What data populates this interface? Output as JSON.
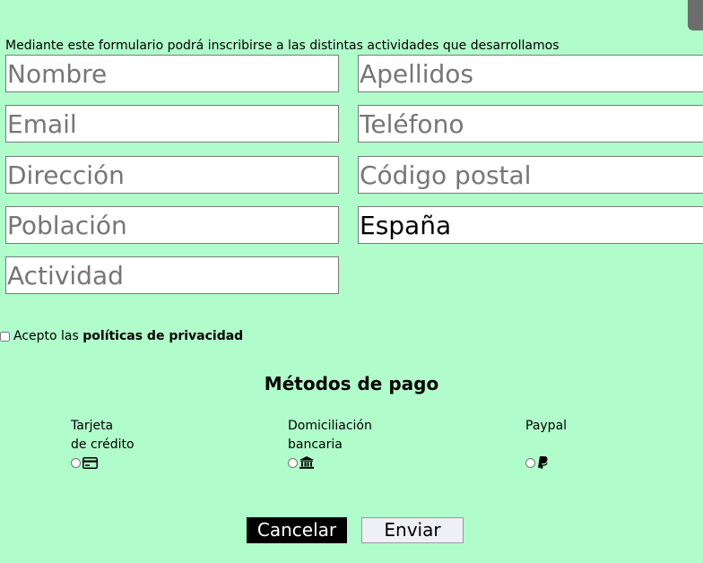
{
  "form": {
    "intro": "Mediante este formulario podrá inscribirse a las distintas actividades que desarrollamos",
    "fields": {
      "nombre": {
        "placeholder": "Nombre",
        "value": ""
      },
      "apellidos": {
        "placeholder": "Apellidos",
        "value": ""
      },
      "email": {
        "placeholder": "Email",
        "value": ""
      },
      "telefono": {
        "placeholder": "Teléfono",
        "value": ""
      },
      "direccion": {
        "placeholder": "Dirección",
        "value": ""
      },
      "codigo_postal": {
        "placeholder": "Código postal",
        "value": ""
      },
      "poblacion": {
        "placeholder": "Población",
        "value": ""
      },
      "pais": {
        "placeholder": "",
        "value": "España"
      },
      "actividad": {
        "placeholder": "Actividad",
        "value": ""
      }
    },
    "consent": {
      "prefix": "Acepto las ",
      "link": "políticas de privacidad",
      "checked": false
    }
  },
  "payment": {
    "title": "Métodos de pago",
    "options": [
      {
        "line1": "Tarjeta",
        "line2": "de crédito",
        "icon": "credit-card-icon",
        "selected": false
      },
      {
        "line1": "Domiciliación",
        "line2": "bancaria",
        "icon": "bank-icon",
        "selected": false
      },
      {
        "line1": "Paypal",
        "line2": "",
        "icon": "paypal-icon",
        "selected": false
      }
    ]
  },
  "actions": {
    "cancel_label": "Cancelar",
    "send_label": "Enviar"
  },
  "colors": {
    "background": "#b0fccb",
    "cancel_bg": "#000000",
    "send_bg": "#efeff6"
  }
}
